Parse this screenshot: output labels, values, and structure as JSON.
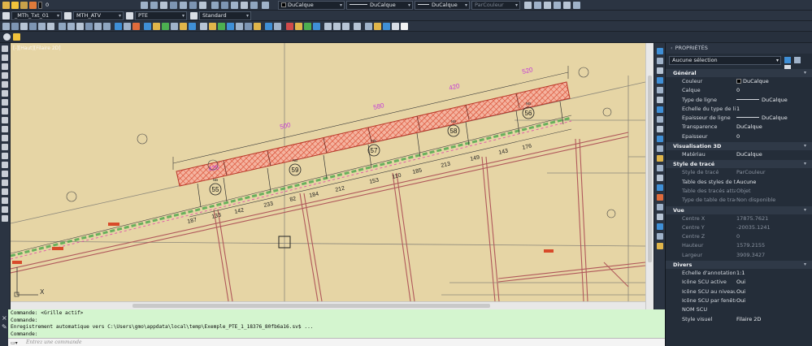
{
  "toolbar_top": {
    "layer_value": "0",
    "color_value": "DuCalque",
    "linetype_value": "DuCalque",
    "lineweight_value": "DuCalque",
    "plotstyle_value": "ParCouleur"
  },
  "toolbar_styles": {
    "text_style": "_MTh_Txt_01",
    "dim_style": "MTH_ATV",
    "table_style": "PTE",
    "multileader_style": "Standard"
  },
  "viewport": {
    "label": "[-][Haut][Filaire 2D]"
  },
  "drawing": {
    "segment_dims": [
      "425",
      "500",
      "580",
      "420",
      "520"
    ],
    "sub_dims": [
      "187",
      "133",
      "142",
      "233",
      "82",
      "184",
      "212",
      "153",
      "110",
      "185",
      "213",
      "149",
      "143",
      "176"
    ],
    "markers": [
      "55",
      "59",
      "57",
      "58",
      "56"
    ],
    "markers_lower": [
      "55",
      "59",
      "57",
      "58",
      "56"
    ],
    "axis_x_label": "X",
    "axis_y_label": "Y"
  },
  "properties": {
    "title": "PROPRIÉTÉS",
    "selection": "Aucune sélection",
    "sections": [
      {
        "name": "Général",
        "rows": [
          {
            "k": "Couleur",
            "v": "DuCalque"
          },
          {
            "k": "Calque",
            "v": "0"
          },
          {
            "k": "Type de ligne",
            "v": "DuCalque"
          },
          {
            "k": "Echelle du type de li...",
            "v": "1"
          },
          {
            "k": "Epaisseur de ligne",
            "v": "DuCalque"
          },
          {
            "k": "Transparence",
            "v": "DuCalque"
          },
          {
            "k": "Epaisseur",
            "v": "0"
          }
        ]
      },
      {
        "name": "Visualisation 3D",
        "rows": [
          {
            "k": "Matériau",
            "v": "DuCalque"
          }
        ]
      },
      {
        "name": "Style de tracé",
        "rows": [
          {
            "k": "Style de tracé",
            "v": "ParCouleur"
          },
          {
            "k": "Table des styles de tr...",
            "v": "Aucune"
          },
          {
            "k": "Table des tracés atta...",
            "v": "Objet"
          },
          {
            "k": "Type de table de tracé",
            "v": "Non disponible"
          }
        ]
      },
      {
        "name": "Vue",
        "rows": [
          {
            "k": "Centre X",
            "v": "17875.7621"
          },
          {
            "k": "Centre Y",
            "v": "-20035.1241"
          },
          {
            "k": "Centre Z",
            "v": "0"
          },
          {
            "k": "Hauteur",
            "v": "1579.2155"
          },
          {
            "k": "Largeur",
            "v": "3909.3427"
          }
        ]
      },
      {
        "name": "Divers",
        "rows": [
          {
            "k": "Echelle d'annotation",
            "v": "1:1"
          },
          {
            "k": "Icône SCU active",
            "v": "Oui"
          },
          {
            "k": "Icône SCU au niveau...",
            "v": "Oui"
          },
          {
            "k": "Icône SCU par fenêtre",
            "v": "Oui"
          },
          {
            "k": "NOM SCU",
            "v": ""
          },
          {
            "k": "Style visuel",
            "v": "Filaire 2D"
          }
        ]
      }
    ]
  },
  "command": {
    "history": [
      "Commande:  <Grille actif>",
      "Commande:",
      "Enregistrement automatique vers C:\\Users\\gmo\\appdata\\local\\temp\\Exemple_PTE_1_18376_80fb6a16.sv$ ...",
      "Commande:"
    ],
    "placeholder": "Entrez une commande"
  },
  "colors": {
    "drawing_bg": "#e6d5a5",
    "hatch": "#e0583a",
    "dimension": "#c43bd6",
    "cmd_bg": "#d4f5cf"
  }
}
